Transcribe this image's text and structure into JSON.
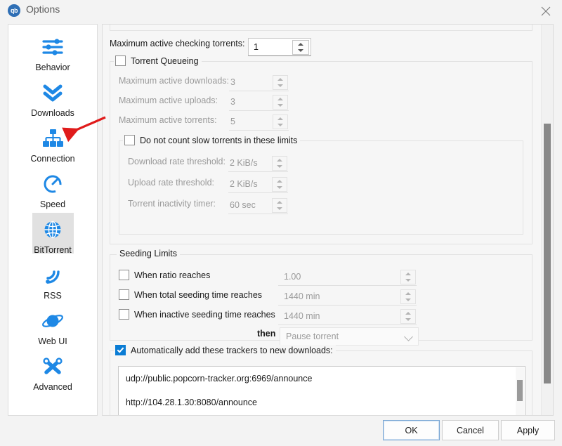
{
  "window": {
    "title": "Options",
    "logo_text": "qb",
    "logo_icon": "qbittorrent-logo-icon",
    "close_icon": "close-icon"
  },
  "sidebar": {
    "items": [
      {
        "label": "Behavior",
        "icon": "sliders-icon",
        "selected": false
      },
      {
        "label": "Downloads",
        "icon": "double-chevron-down-icon",
        "selected": false
      },
      {
        "label": "Connection",
        "icon": "network-nodes-icon",
        "selected": false
      },
      {
        "label": "Speed",
        "icon": "speedometer-icon",
        "selected": false
      },
      {
        "label": "BitTorrent",
        "icon": "globe-icon",
        "selected": true
      },
      {
        "label": "RSS",
        "icon": "rss-icon",
        "selected": false
      },
      {
        "label": "Web UI",
        "icon": "planet-icon",
        "selected": false
      },
      {
        "label": "Advanced",
        "icon": "wrench-screwdriver-icon",
        "selected": false
      }
    ]
  },
  "main": {
    "max_checking": {
      "label": "Maximum active checking torrents:",
      "value": "1"
    },
    "queueing": {
      "title": "Torrent Queueing",
      "checked": false,
      "rows": [
        {
          "label": "Maximum active downloads:",
          "value": "3"
        },
        {
          "label": "Maximum active uploads:",
          "value": "3"
        },
        {
          "label": "Maximum active torrents:",
          "value": "5"
        }
      ],
      "slow": {
        "title": "Do not count slow torrents in these limits",
        "checked": false,
        "rows": [
          {
            "label": "Download rate threshold:",
            "value": "2 KiB/s"
          },
          {
            "label": "Upload rate threshold:",
            "value": "2 KiB/s"
          },
          {
            "label": "Torrent inactivity timer:",
            "value": "60 sec"
          }
        ]
      }
    },
    "seeding": {
      "title": "Seeding Limits",
      "rows": [
        {
          "label": "When ratio reaches",
          "value": "1.00",
          "checked": false
        },
        {
          "label": "When total seeding time reaches",
          "value": "1440 min",
          "checked": false
        },
        {
          "label": "When inactive seeding time reaches",
          "value": "1440 min",
          "checked": false
        }
      ],
      "then_label": "then",
      "then_value": "Pause torrent"
    },
    "trackers": {
      "title": "Automatically add these trackers to new downloads:",
      "checked": true,
      "lines": [
        "udp://public.popcorn-tracker.org:6969/announce",
        "http://104.28.1.30:8080/announce"
      ]
    }
  },
  "footer": {
    "ok": "OK",
    "cancel": "Cancel",
    "apply": "Apply"
  },
  "annotation": {
    "arrow_color": "#e01b1b",
    "target": "Connection"
  },
  "colors": {
    "accent": "#1e88e5",
    "checked_box": "#0a7cd4",
    "selection": "#e1e1e1"
  }
}
